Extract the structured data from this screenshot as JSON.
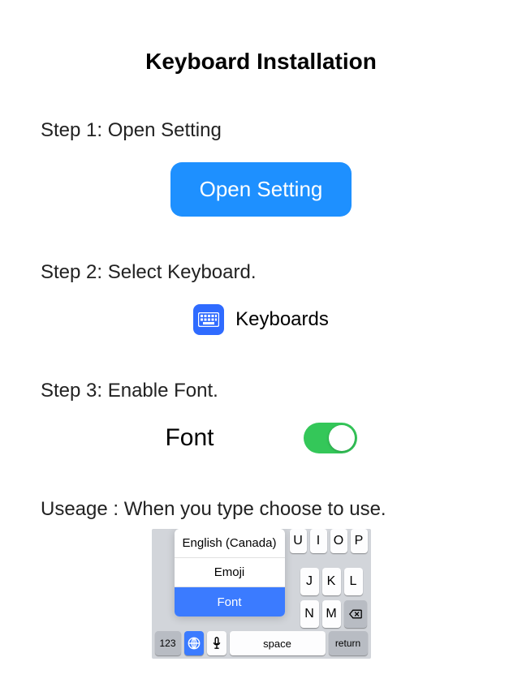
{
  "title": "Keyboard Installation",
  "step1": {
    "heading": "Step 1: Open Setting",
    "button": "Open Setting"
  },
  "step2": {
    "heading": "Step 2: Select Keyboard.",
    "row_label": "Keyboards"
  },
  "step3": {
    "heading": "Step 3: Enable Font.",
    "font_label": "Font",
    "toggle_on": true
  },
  "usage": {
    "heading": "Useage : When you type choose to use.",
    "popup": [
      "English (Canada)",
      "Emoji",
      "Font"
    ],
    "popup_selected_index": 2,
    "keys_top": [
      "U",
      "I",
      "O",
      "P"
    ],
    "keys_mid": [
      "J",
      "K",
      "L"
    ],
    "keys_low": [
      "N",
      "M"
    ],
    "key_123": "123",
    "key_space": "space",
    "key_return": "return"
  }
}
